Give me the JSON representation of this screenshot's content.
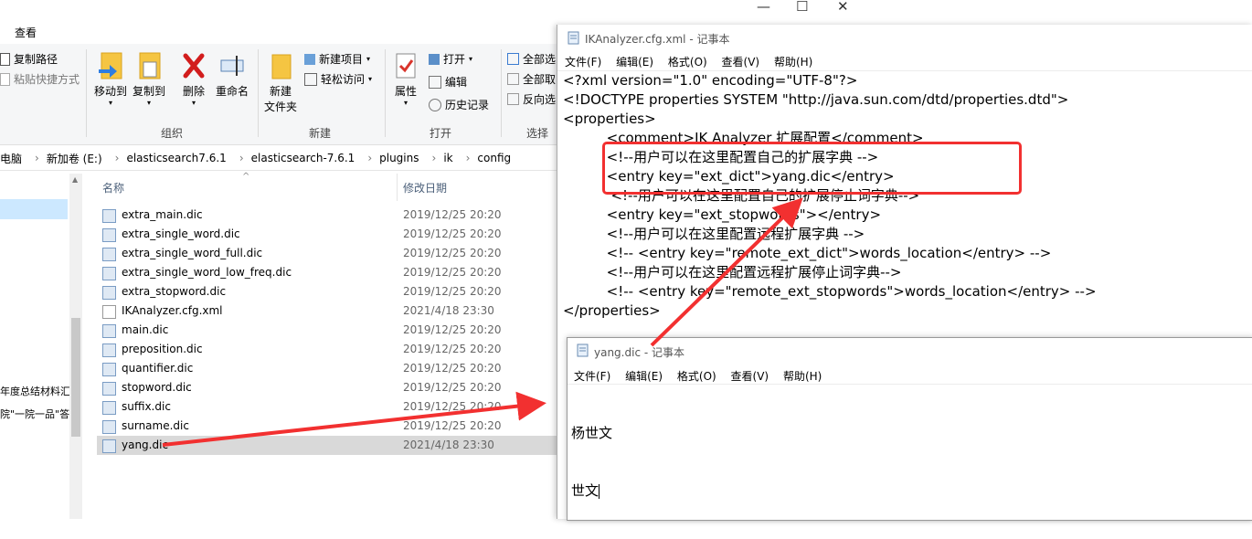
{
  "explorer": {
    "tab_view": "查看",
    "ribbon": {
      "copy_path": "复制路径",
      "paste_shortcut": "粘贴快捷方式",
      "move_to": "移动到",
      "copy_to": "复制到",
      "delete": "删除",
      "rename": "重命名",
      "new_folder_l1": "新建",
      "new_folder_l2": "文件夹",
      "new_item": "新建项目",
      "easy_access": "轻松访问",
      "properties": "属性",
      "open": "打开",
      "edit": "编辑",
      "history": "历史记录",
      "select_all": "全部选",
      "select_none": "全部取",
      "invert_select": "反向选",
      "group_organize": "组织",
      "group_new": "新建",
      "group_open": "打开",
      "group_select": "选择"
    },
    "breadcrumb": [
      "电脑",
      "新加卷 (E:)",
      "elasticsearch7.6.1",
      "elasticsearch-7.6.1",
      "plugins",
      "ik",
      "config"
    ],
    "nav_items": [
      "年度总结材料汇",
      "院\"一院一品\"答"
    ],
    "columns": {
      "name": "名称",
      "modified": "修改日期"
    },
    "files": [
      {
        "name": "extra_main.dic",
        "date": "2019/12/25 20:20"
      },
      {
        "name": "extra_single_word.dic",
        "date": "2019/12/25 20:20"
      },
      {
        "name": "extra_single_word_full.dic",
        "date": "2019/12/25 20:20"
      },
      {
        "name": "extra_single_word_low_freq.dic",
        "date": "2019/12/25 20:20"
      },
      {
        "name": "extra_stopword.dic",
        "date": "2019/12/25 20:20"
      },
      {
        "name": "IKAnalyzer.cfg.xml",
        "date": "2021/4/18 23:30"
      },
      {
        "name": "main.dic",
        "date": "2019/12/25 20:20"
      },
      {
        "name": "preposition.dic",
        "date": "2019/12/25 20:20"
      },
      {
        "name": "quantifier.dic",
        "date": "2019/12/25 20:20"
      },
      {
        "name": "stopword.dic",
        "date": "2019/12/25 20:20"
      },
      {
        "name": "suffix.dic",
        "date": "2019/12/25 20:20"
      },
      {
        "name": "surname.dic",
        "date": "2019/12/25 20:20"
      },
      {
        "name": "yang.dic",
        "date": "2021/4/18 23:30"
      }
    ]
  },
  "notepad_cfg": {
    "title": "IKAnalyzer.cfg.xml - 记事本",
    "menu": [
      "文件(F)",
      "编辑(E)",
      "格式(O)",
      "查看(V)",
      "帮助(H)"
    ],
    "lines": [
      "<?xml version=\"1.0\" encoding=\"UTF-8\"?>",
      "<!DOCTYPE properties SYSTEM \"http://java.sun.com/dtd/properties.dtd\">",
      "<properties>",
      "          <comment>IK Analyzer 扩展配置</comment>",
      "          <!--用户可以在这里配置自己的扩展字典 -->",
      "          <entry key=\"ext_dict\">yang.dic</entry>",
      "           <!--用户可以在这里配置自己的扩展停止词字典-->",
      "          <entry key=\"ext_stopwords\"></entry>",
      "          <!--用户可以在这里配置远程扩展字典 -->",
      "          <!-- <entry key=\"remote_ext_dict\">words_location</entry> -->",
      "          <!--用户可以在这里配置远程扩展停止词字典-->",
      "          <!-- <entry key=\"remote_ext_stopwords\">words_location</entry> -->",
      "</properties>"
    ]
  },
  "notepad_dic": {
    "title": "yang.dic - 记事本",
    "menu": [
      "文件(F)",
      "编辑(E)",
      "格式(O)",
      "查看(V)",
      "帮助(H)"
    ],
    "lines": [
      "杨世文",
      "世文"
    ]
  },
  "colors": {
    "annotation": "#f23030",
    "selection": "#cce8ff"
  }
}
